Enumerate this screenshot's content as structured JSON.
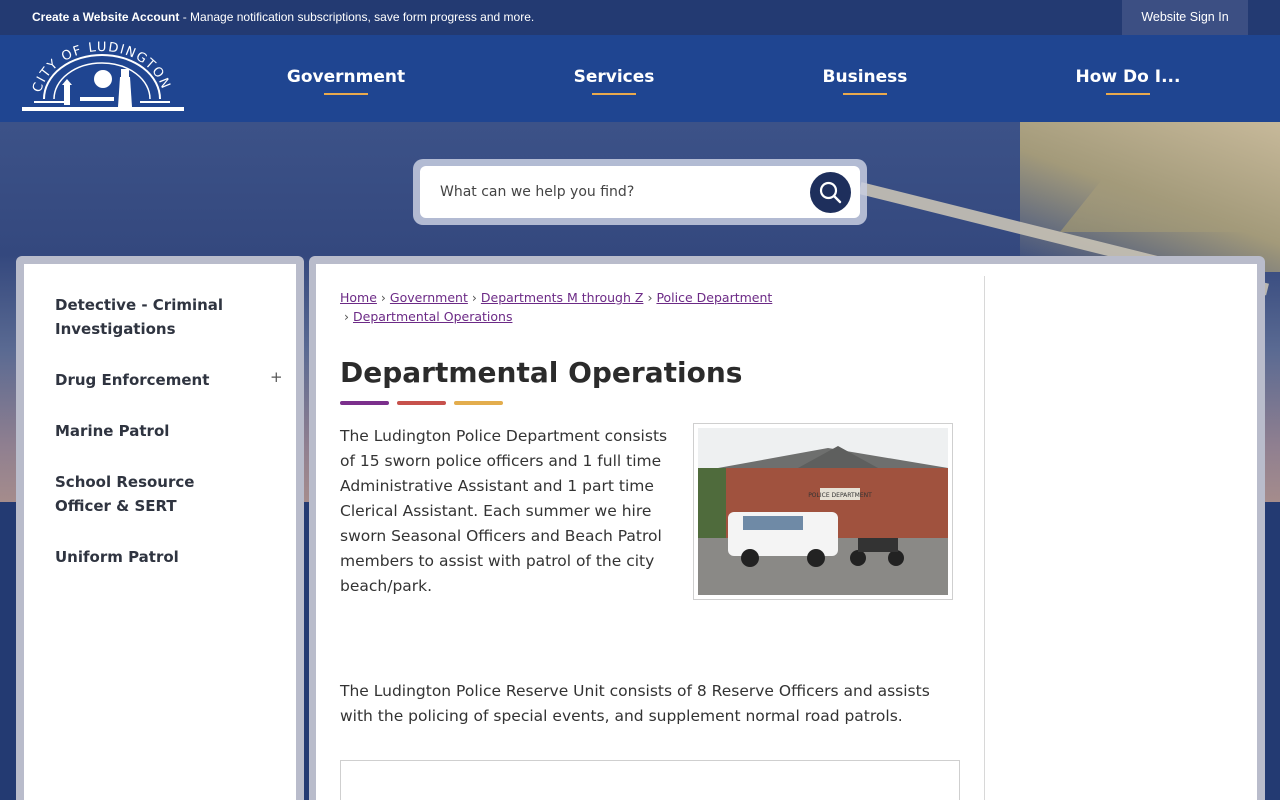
{
  "topbar": {
    "create_account": "Create a Website Account",
    "message": " - Manage notification subscriptions, save form progress and more.",
    "sign_in": "Website Sign In"
  },
  "header": {
    "logo_alt": "City of Ludington",
    "nav": [
      "Government",
      "Services",
      "Business",
      "How Do I..."
    ]
  },
  "search": {
    "placeholder": "What can we help you find?"
  },
  "sidebar": {
    "items": [
      {
        "label": "Detective - Criminal Investigations",
        "expandable": false
      },
      {
        "label": "Drug Enforcement",
        "expandable": true
      },
      {
        "label": "Marine Patrol",
        "expandable": false
      },
      {
        "label": "School Resource Officer & SERT",
        "expandable": false
      },
      {
        "label": "Uniform Patrol",
        "expandable": false
      }
    ],
    "expand_symbol": "+"
  },
  "breadcrumb": [
    "Home",
    "Government",
    "Departments M through Z",
    "Police Department",
    "Departmental Operations"
  ],
  "page": {
    "title": "Departmental Operations",
    "accent_colors": [
      "#7b2f8c",
      "#c7514c",
      "#e3ad4d"
    ],
    "paragraph1": "The Ludington Police Department consists of 15 sworn police officers and 1 full time Administrative Assistant and 1 part time Clerical Assistant. Each summer we hire sworn Seasonal Officers and Beach Patrol members to assist with patrol of the city beach/park.",
    "paragraph2": "The Ludington Police Reserve Unit consists of 8 Reserve Officers and assists with the policing of special events, and supplement normal road patrols.",
    "photo_sign": "POLICE DEPARTMENT"
  },
  "colors": {
    "topbar": "#233a72",
    "header": "#1f4591",
    "nav_underline": "#e9a94d",
    "link": "#6c2a86"
  }
}
